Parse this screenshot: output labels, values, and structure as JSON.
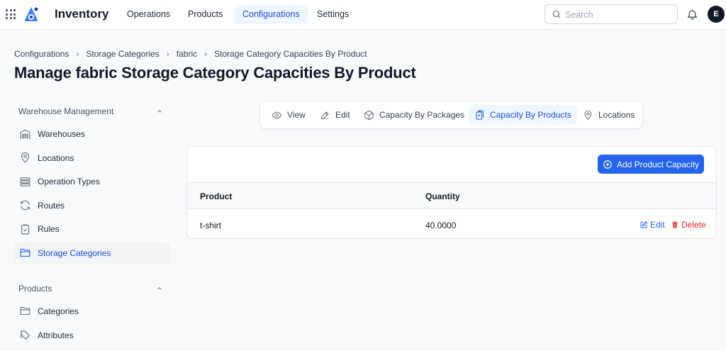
{
  "app": {
    "brand": "Inventory",
    "avatar_initial": "E"
  },
  "nav": [
    {
      "label": "Operations",
      "active": false
    },
    {
      "label": "Products",
      "active": false
    },
    {
      "label": "Configurations",
      "active": true
    },
    {
      "label": "Settings",
      "active": false
    }
  ],
  "search": {
    "placeholder": "Search",
    "value": ""
  },
  "breadcrumb": [
    "Configurations",
    "Storage Categories",
    "fabric",
    "Storage Category Capacities By Product"
  ],
  "page": {
    "title": "Manage fabric Storage Category Capacities By Product"
  },
  "sidebar": {
    "sections": [
      {
        "title": "Warehouse Management",
        "items": [
          {
            "label": "Warehouses",
            "icon": "warehouse-icon",
            "active": false
          },
          {
            "label": "Locations",
            "icon": "map-pin-icon",
            "active": false
          },
          {
            "label": "Operation Types",
            "icon": "stack-icon",
            "active": false
          },
          {
            "label": "Routes",
            "icon": "refresh-icon",
            "active": false
          },
          {
            "label": "Rules",
            "icon": "clipboard-check-icon",
            "active": false
          },
          {
            "label": "Storage Categories",
            "icon": "folder-icon",
            "active": true
          }
        ]
      },
      {
        "title": "Products",
        "items": [
          {
            "label": "Categories",
            "icon": "folder-icon",
            "active": false
          },
          {
            "label": "Attributes",
            "icon": "tag-icon",
            "active": false
          }
        ]
      }
    ]
  },
  "tabs": [
    {
      "label": "View",
      "icon": "eye-icon",
      "active": false
    },
    {
      "label": "Edit",
      "icon": "pencil-icon",
      "active": false
    },
    {
      "label": "Capacity By Packages",
      "icon": "cube-icon",
      "active": false
    },
    {
      "label": "Capacity By Products",
      "icon": "clipboard-icon",
      "active": true
    },
    {
      "label": "Locations",
      "icon": "map-pin-icon",
      "active": false
    }
  ],
  "table": {
    "add_button": "Add Product Capacity",
    "columns": [
      "Product",
      "Quantity"
    ],
    "rows": [
      {
        "product": "t-shirt",
        "quantity": "40.0000"
      }
    ],
    "actions": {
      "edit": "Edit",
      "delete": "Delete"
    }
  },
  "colors": {
    "accent": "#2563eb",
    "danger": "#dc2626",
    "active_bg": "#eff6ff"
  }
}
